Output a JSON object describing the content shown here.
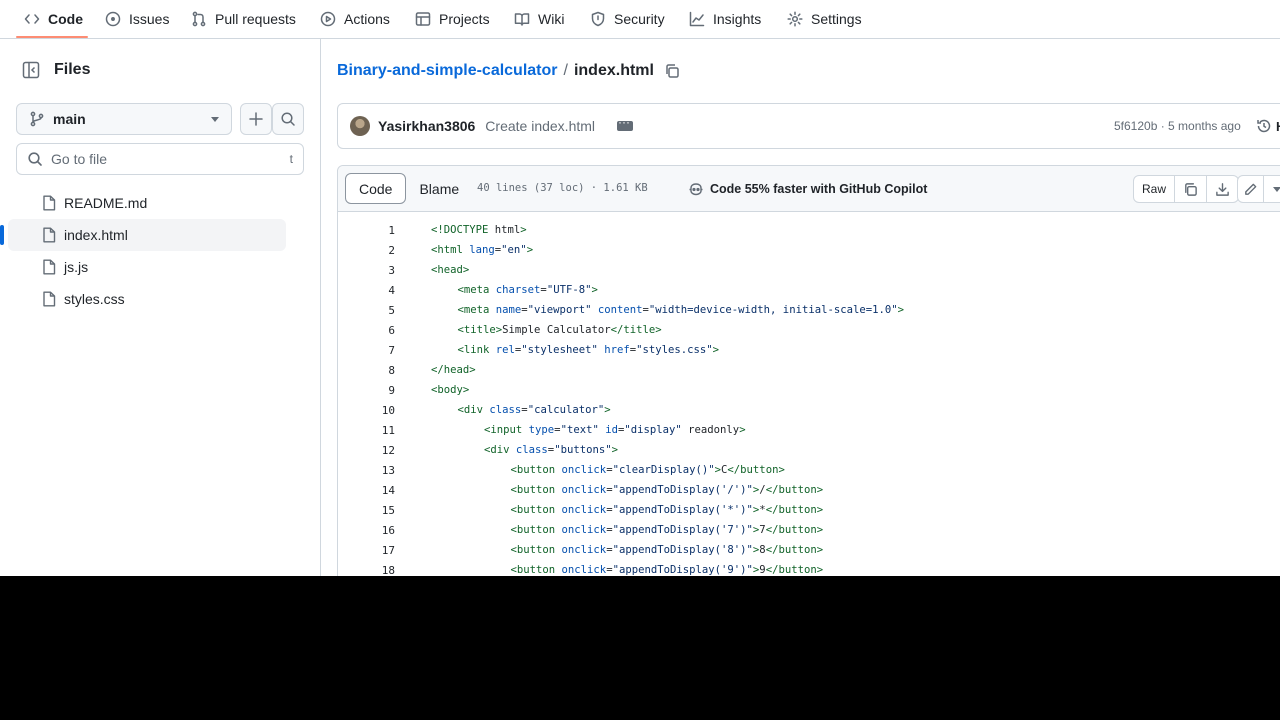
{
  "nav": {
    "tabs": [
      {
        "label": "Code",
        "icon": "code-icon"
      },
      {
        "label": "Issues",
        "icon": "issue-icon"
      },
      {
        "label": "Pull requests",
        "icon": "pull-request-icon"
      },
      {
        "label": "Actions",
        "icon": "play-icon"
      },
      {
        "label": "Projects",
        "icon": "table-icon"
      },
      {
        "label": "Wiki",
        "icon": "book-icon"
      },
      {
        "label": "Security",
        "icon": "shield-icon"
      },
      {
        "label": "Insights",
        "icon": "graph-icon"
      },
      {
        "label": "Settings",
        "icon": "gear-icon"
      }
    ]
  },
  "sidebar": {
    "title": "Files",
    "branch": "main",
    "go_to_file_placeholder": "Go to file",
    "go_to_file_shortcut": "t",
    "files": [
      {
        "name": "README.md",
        "selected": false
      },
      {
        "name": "index.html",
        "selected": true
      },
      {
        "name": "js.js",
        "selected": false
      },
      {
        "name": "styles.css",
        "selected": false
      }
    ]
  },
  "breadcrumb": {
    "repo": "Binary-and-simple-calculator",
    "separator": "/",
    "file": "index.html"
  },
  "commit": {
    "author": "Yasirkhan3806",
    "message": "Create index.html",
    "meta": "5f6120b · 5 months ago",
    "history_label": "H"
  },
  "file_header": {
    "tab_code": "Code",
    "tab_blame": "Blame",
    "info": "40 lines (37 loc) · 1.61 KB",
    "copilot": "Code 55% faster with GitHub Copilot",
    "raw": "Raw"
  },
  "code_lines": [
    {
      "n": "1",
      "indent": 0,
      "text": "<!DOCTYPE html>"
    },
    {
      "n": "2",
      "indent": 0,
      "text": "<html lang=\"en\">"
    },
    {
      "n": "3",
      "indent": 0,
      "text": "<head>"
    },
    {
      "n": "4",
      "indent": 1,
      "text": "<meta charset=\"UTF-8\">"
    },
    {
      "n": "5",
      "indent": 1,
      "text": "<meta name=\"viewport\" content=\"width=device-width, initial-scale=1.0\">"
    },
    {
      "n": "6",
      "indent": 1,
      "text": "<title>Simple Calculator</title>"
    },
    {
      "n": "7",
      "indent": 1,
      "text": "<link rel=\"stylesheet\" href=\"styles.css\">"
    },
    {
      "n": "8",
      "indent": 0,
      "text": "</head>"
    },
    {
      "n": "9",
      "indent": 0,
      "text": "<body>"
    },
    {
      "n": "10",
      "indent": 1,
      "text": "<div class=\"calculator\">"
    },
    {
      "n": "11",
      "indent": 2,
      "text": "<input type=\"text\" id=\"display\" readonly>"
    },
    {
      "n": "12",
      "indent": 2,
      "text": "<div class=\"buttons\">"
    },
    {
      "n": "13",
      "indent": 3,
      "text": "<button onclick=\"clearDisplay()\">C</button>"
    },
    {
      "n": "14",
      "indent": 3,
      "text": "<button onclick=\"appendToDisplay('/')\">/</button>"
    },
    {
      "n": "15",
      "indent": 3,
      "text": "<button onclick=\"appendToDisplay('*')\">*</button>"
    },
    {
      "n": "16",
      "indent": 3,
      "text": "<button onclick=\"appendToDisplay('7')\">7</button>"
    },
    {
      "n": "17",
      "indent": 3,
      "text": "<button onclick=\"appendToDisplay('8')\">8</button>"
    },
    {
      "n": "18",
      "indent": 3,
      "text": "<button onclick=\"appendToDisplay('9')\">9</button>"
    }
  ]
}
